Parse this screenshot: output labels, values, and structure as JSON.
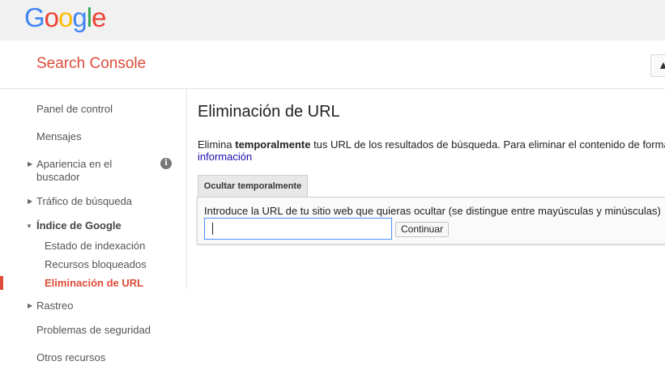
{
  "brand": {
    "logo_letters": [
      "G",
      "o",
      "o",
      "g",
      "l",
      "e"
    ],
    "logo_colors": [
      "#4285F4",
      "#EA4335",
      "#FBBC05",
      "#4285F4",
      "#34A853",
      "#EA4335"
    ],
    "product": "Search Console",
    "accent": "#dd4b39"
  },
  "sidebar": {
    "items": [
      {
        "label": "Panel de control"
      },
      {
        "label": "Mensajes"
      },
      {
        "label": "Apariencia en el"
      },
      {
        "label": "buscador"
      },
      {
        "label": "Tráfico de búsqueda"
      },
      {
        "label": "Índice de Google"
      },
      {
        "label": "Estado de indexación"
      },
      {
        "label": "Recursos bloqueados"
      },
      {
        "label": "Eliminación de URL"
      },
      {
        "label": "Rastreo"
      },
      {
        "label": "Problemas de seguridad"
      },
      {
        "label": "Otros recursos"
      }
    ]
  },
  "main": {
    "title": "Eliminación de URL",
    "desc_prefix": "Elimina ",
    "desc_bold": "temporalmente",
    "desc_suffix": " tus URL de los resultados de búsqueda. Para eliminar el contenido de forma",
    "more_link": "información",
    "tab": "Ocultar temporalmente",
    "input_label": "Introduce la URL de tu sitio web que quieras ocultar (se distingue entre mayúsculas y minúsculas)",
    "input_value": "",
    "continue_label": "Continuar"
  }
}
